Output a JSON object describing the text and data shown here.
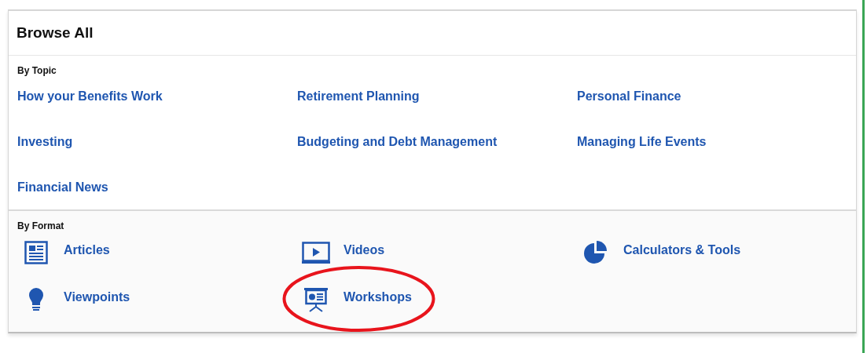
{
  "title": "Browse All",
  "by_topic": {
    "heading": "By Topic",
    "links": [
      {
        "label": "How your Benefits Work"
      },
      {
        "label": "Retirement Planning"
      },
      {
        "label": "Personal Finance"
      },
      {
        "label": "Investing"
      },
      {
        "label": "Budgeting and Debt Management"
      },
      {
        "label": "Managing Life Events"
      },
      {
        "label": "Financial News"
      }
    ]
  },
  "by_format": {
    "heading": "By Format",
    "links": [
      {
        "label": "Articles",
        "kind": "article"
      },
      {
        "label": "Videos",
        "kind": "video"
      },
      {
        "label": "Calculators & Tools",
        "kind": "calculator"
      },
      {
        "label": "Viewpoints",
        "kind": "viewpoint"
      },
      {
        "label": "Workshops",
        "kind": "workshop",
        "circled": true
      }
    ]
  }
}
